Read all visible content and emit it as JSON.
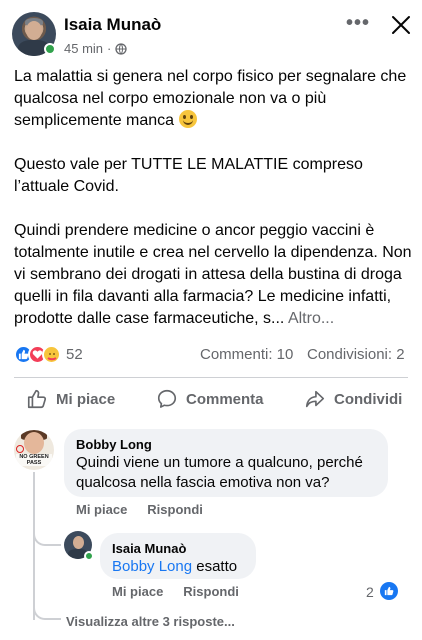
{
  "post": {
    "author": "Isaia Munaò",
    "time": "45 min",
    "separator": "·",
    "globe_icon": "globe-icon",
    "paragraphs": [
      "La malattia si genera nel corpo fisico per segnalare che qualcosa nel corpo emozionale non va o più semplicemente manca",
      "Questo vale per TUTTE LE MALATTIE compreso l’attuale Covid.",
      "Quindi prendere medicine o ancor peggio vaccini è totalmente inutile e crea nel cervello la dipendenza. Non vi sembrano dei drogati in attesa della bustina di droga quelli in fila davanti alla farmacia? Le medicine infatti, prodotte dalle case farmaceutiche, s..."
    ],
    "more_link": "Altro..."
  },
  "stats": {
    "reaction_count": "52",
    "comments": "Commenti: 10",
    "shares": "Condivisioni: 2"
  },
  "actions": {
    "like": "Mi piace",
    "comment": "Commenta",
    "share": "Condividi"
  },
  "comments": [
    {
      "author": "Bobby Long",
      "avatar_text": "NO GREEN PASS",
      "text": "Quindi viene un tumore a qualcuno, perché qualcosa nella fascia emotiva non va?",
      "like": "Mi piace",
      "reply": "Rispondi"
    }
  ],
  "reply": {
    "author": "Isaia Munaò",
    "mention": "Bobby Long",
    "text": "esatto",
    "like": "Mi piace",
    "reply": "Rispondi",
    "like_count": "2"
  },
  "view_more": "Visualizza altre 3 risposte...",
  "colors": {
    "accent": "#1877f2",
    "love": "#f33e58",
    "online": "#31a24c",
    "secondary_text": "#65676b"
  }
}
